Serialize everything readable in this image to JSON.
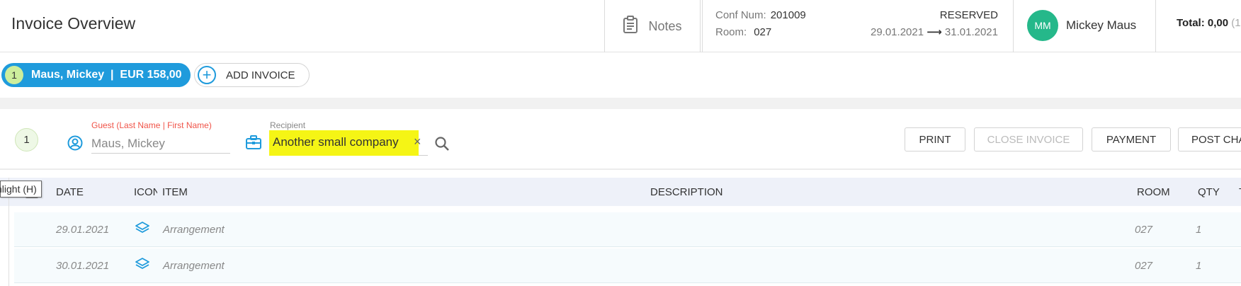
{
  "header": {
    "title": "Invoice Overview",
    "notes_label": "Notes",
    "conf_num_label": "Conf Num:",
    "conf_num": "201009",
    "room_label": "Room:",
    "room": "027",
    "status": "RESERVED",
    "date_from": "29.01.2021",
    "date_arrow": "⟶",
    "date_to": "31.01.2021",
    "user_initials": "MM",
    "user_name": "Mickey Maus",
    "total_label": "Total: 0,00",
    "total_rest": "(1"
  },
  "invoices": {
    "active": {
      "number": "1",
      "label": "Maus, Mickey  |  EUR 158,00"
    },
    "add_label": "ADD INVOICE"
  },
  "invoice_panel": {
    "number": "1",
    "guest_label": "Guest (Last Name | First Name)",
    "guest_value": "Maus, Mickey",
    "recipient_label": "Recipient",
    "recipient_value": "Another small company",
    "clear_symbol": "×",
    "buttons": {
      "print": "PRINT",
      "close_invoice": "CLOSE INVOICE",
      "payment": "PAYMENT",
      "post_charge": "POST CHA"
    }
  },
  "tooltip": "hlight (H)",
  "table": {
    "columns": {
      "date": "DATE",
      "icon": "ICON",
      "item": "ITEM",
      "description": "DESCRIPTION",
      "room": "ROOM",
      "qty": "QTY",
      "extra": "T"
    },
    "rows": [
      {
        "date": "29.01.2021",
        "icon": "layers-icon",
        "item": "Arrangement",
        "description": "",
        "room": "027",
        "qty": "1"
      },
      {
        "date": "30.01.2021",
        "icon": "layers-icon",
        "item": "Arrangement",
        "description": "",
        "room": "027",
        "qty": "1"
      }
    ]
  },
  "colors": {
    "accent_blue": "#1f9bdc",
    "avatar_green": "#25b88a",
    "highlight_yellow": "#f5f515",
    "required_red": "#f05348"
  }
}
